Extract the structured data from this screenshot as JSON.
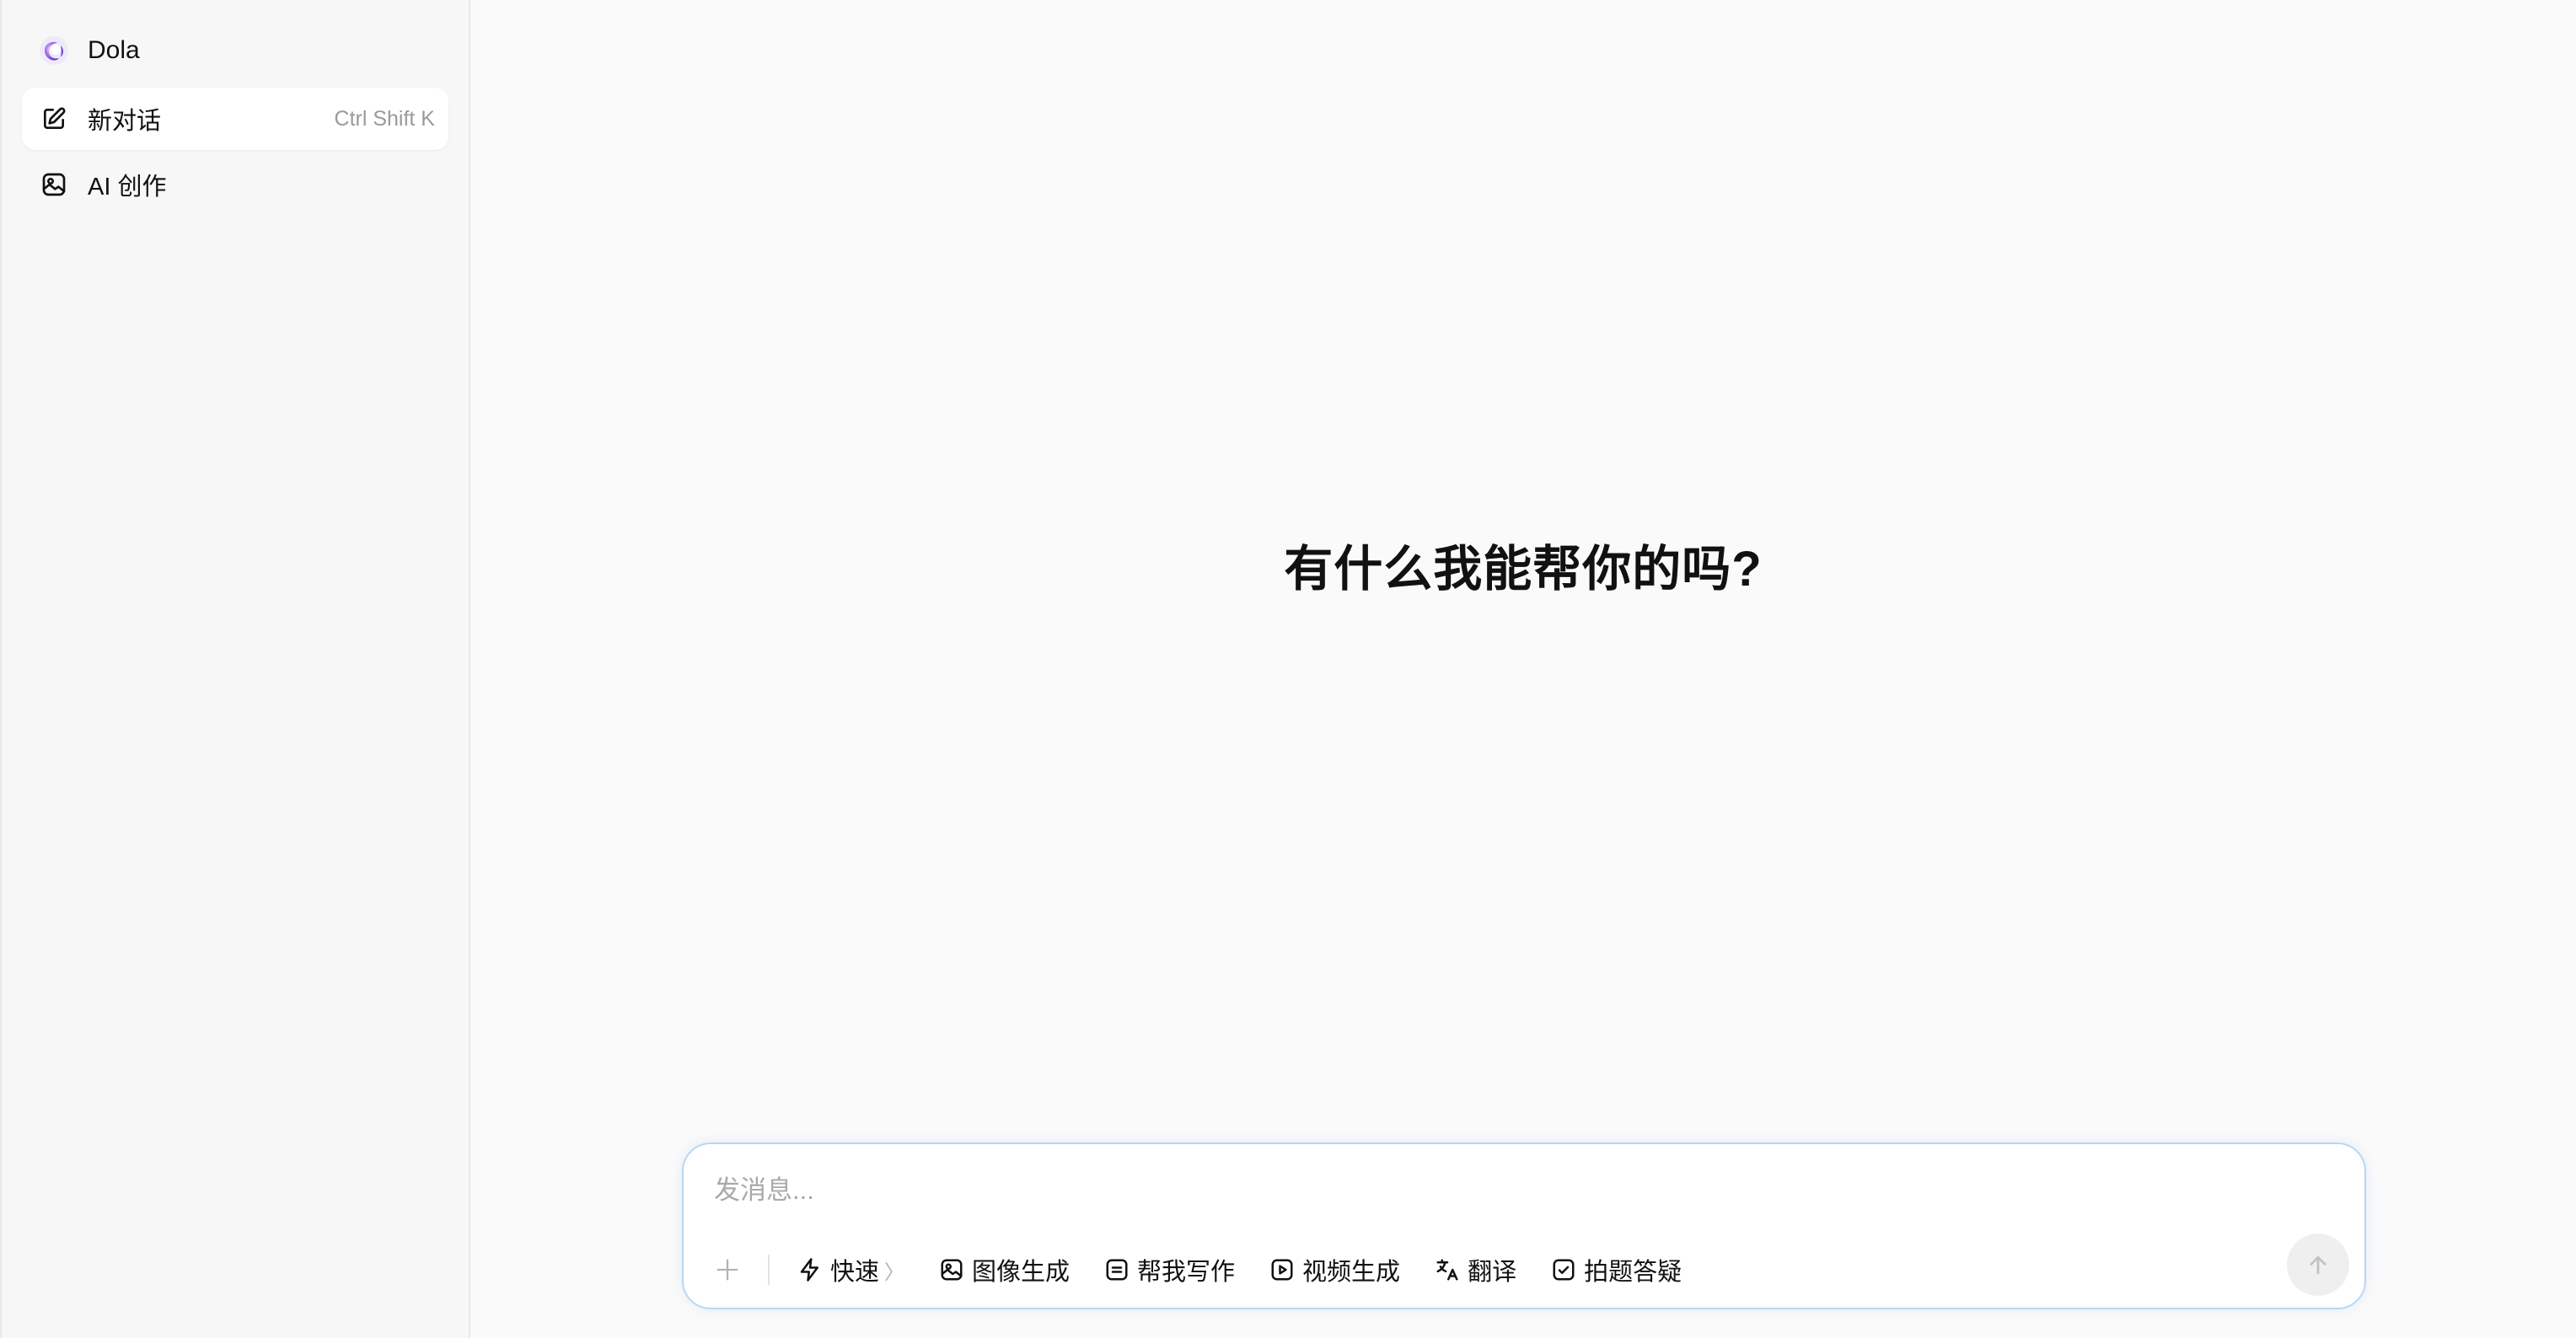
{
  "sidebar": {
    "brand": {
      "name": "Dola",
      "logo_icon": "dola-logo-icon"
    },
    "items": [
      {
        "label": "新对话",
        "shortcut": "Ctrl Shift K",
        "icon": "edit-icon",
        "active": true
      },
      {
        "label": "AI 创作",
        "icon": "image-icon",
        "active": false
      }
    ]
  },
  "main": {
    "greeting": "有什么我能帮你的吗?"
  },
  "composer": {
    "placeholder": "发消息...",
    "tools": [
      {
        "label": "快速",
        "icon": "lightning-icon",
        "has_chevron": true
      },
      {
        "label": "图像生成",
        "icon": "image-icon"
      },
      {
        "label": "帮我写作",
        "icon": "writing-icon"
      },
      {
        "label": "视频生成",
        "icon": "video-icon"
      },
      {
        "label": "翻译",
        "icon": "translate-icon"
      },
      {
        "label": "拍题答疑",
        "icon": "camera-question-icon"
      }
    ],
    "chevron_glyph": "〉"
  },
  "colors": {
    "accent_border": "#b9d6f6",
    "logo_gradient_start": "#8b4fe0",
    "logo_gradient_end": "#3b2db8"
  }
}
